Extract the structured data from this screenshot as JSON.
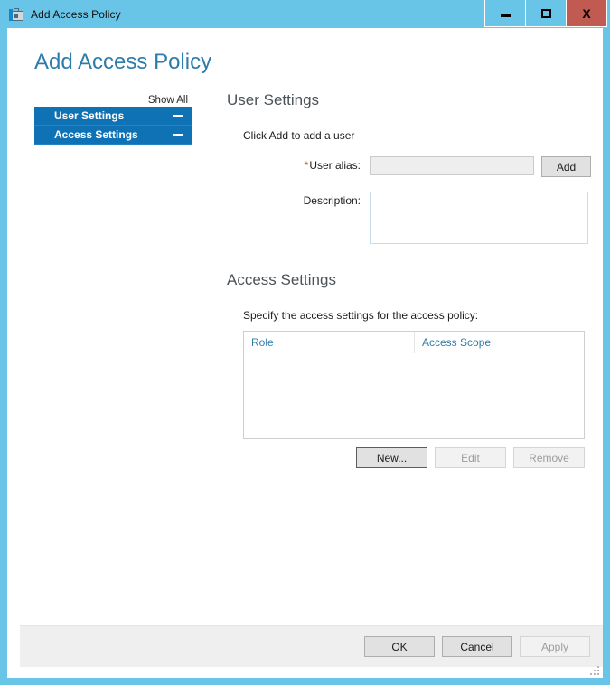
{
  "window": {
    "title": "Add Access Policy",
    "icon": "toolbox-icon",
    "controls": {
      "minimize_label": "Minimize",
      "maximize_label": "Maximize",
      "close_label": "Close",
      "close_glyph": "X"
    },
    "border_color": "#68c5e8",
    "close_color": "#c15a51"
  },
  "page": {
    "title": "Add Access Policy",
    "title_color": "#2e7cab"
  },
  "nav": {
    "show_all_label": "Show All",
    "items": [
      {
        "label": "User Settings",
        "toggle_icon": "collapse-minus-icon",
        "selected": true
      },
      {
        "label": "Access Settings",
        "toggle_icon": "collapse-minus-icon",
        "selected": true
      }
    ],
    "selected_color": "#0f72b5"
  },
  "user_settings": {
    "heading": "User Settings",
    "hint": "Click Add to add a user",
    "alias_required_marker": "*",
    "alias_label": "User alias:",
    "alias_value": "",
    "alias_placeholder": "",
    "add_label": "Add",
    "description_label": "Description:",
    "description_value": "",
    "description_placeholder": ""
  },
  "access_settings": {
    "heading": "Access Settings",
    "hint": "Specify the access settings for the access policy:",
    "columns": [
      "Role",
      "Access Scope"
    ],
    "rows": [],
    "column_color": "#2e7cab",
    "buttons": [
      {
        "label": "New...",
        "state": "default"
      },
      {
        "label": "Edit",
        "state": "disabled"
      },
      {
        "label": "Remove",
        "state": "disabled"
      }
    ]
  },
  "footer": {
    "buttons": [
      {
        "label": "OK",
        "state": "normal"
      },
      {
        "label": "Cancel",
        "state": "normal"
      },
      {
        "label": "Apply",
        "state": "disabled"
      }
    ]
  }
}
